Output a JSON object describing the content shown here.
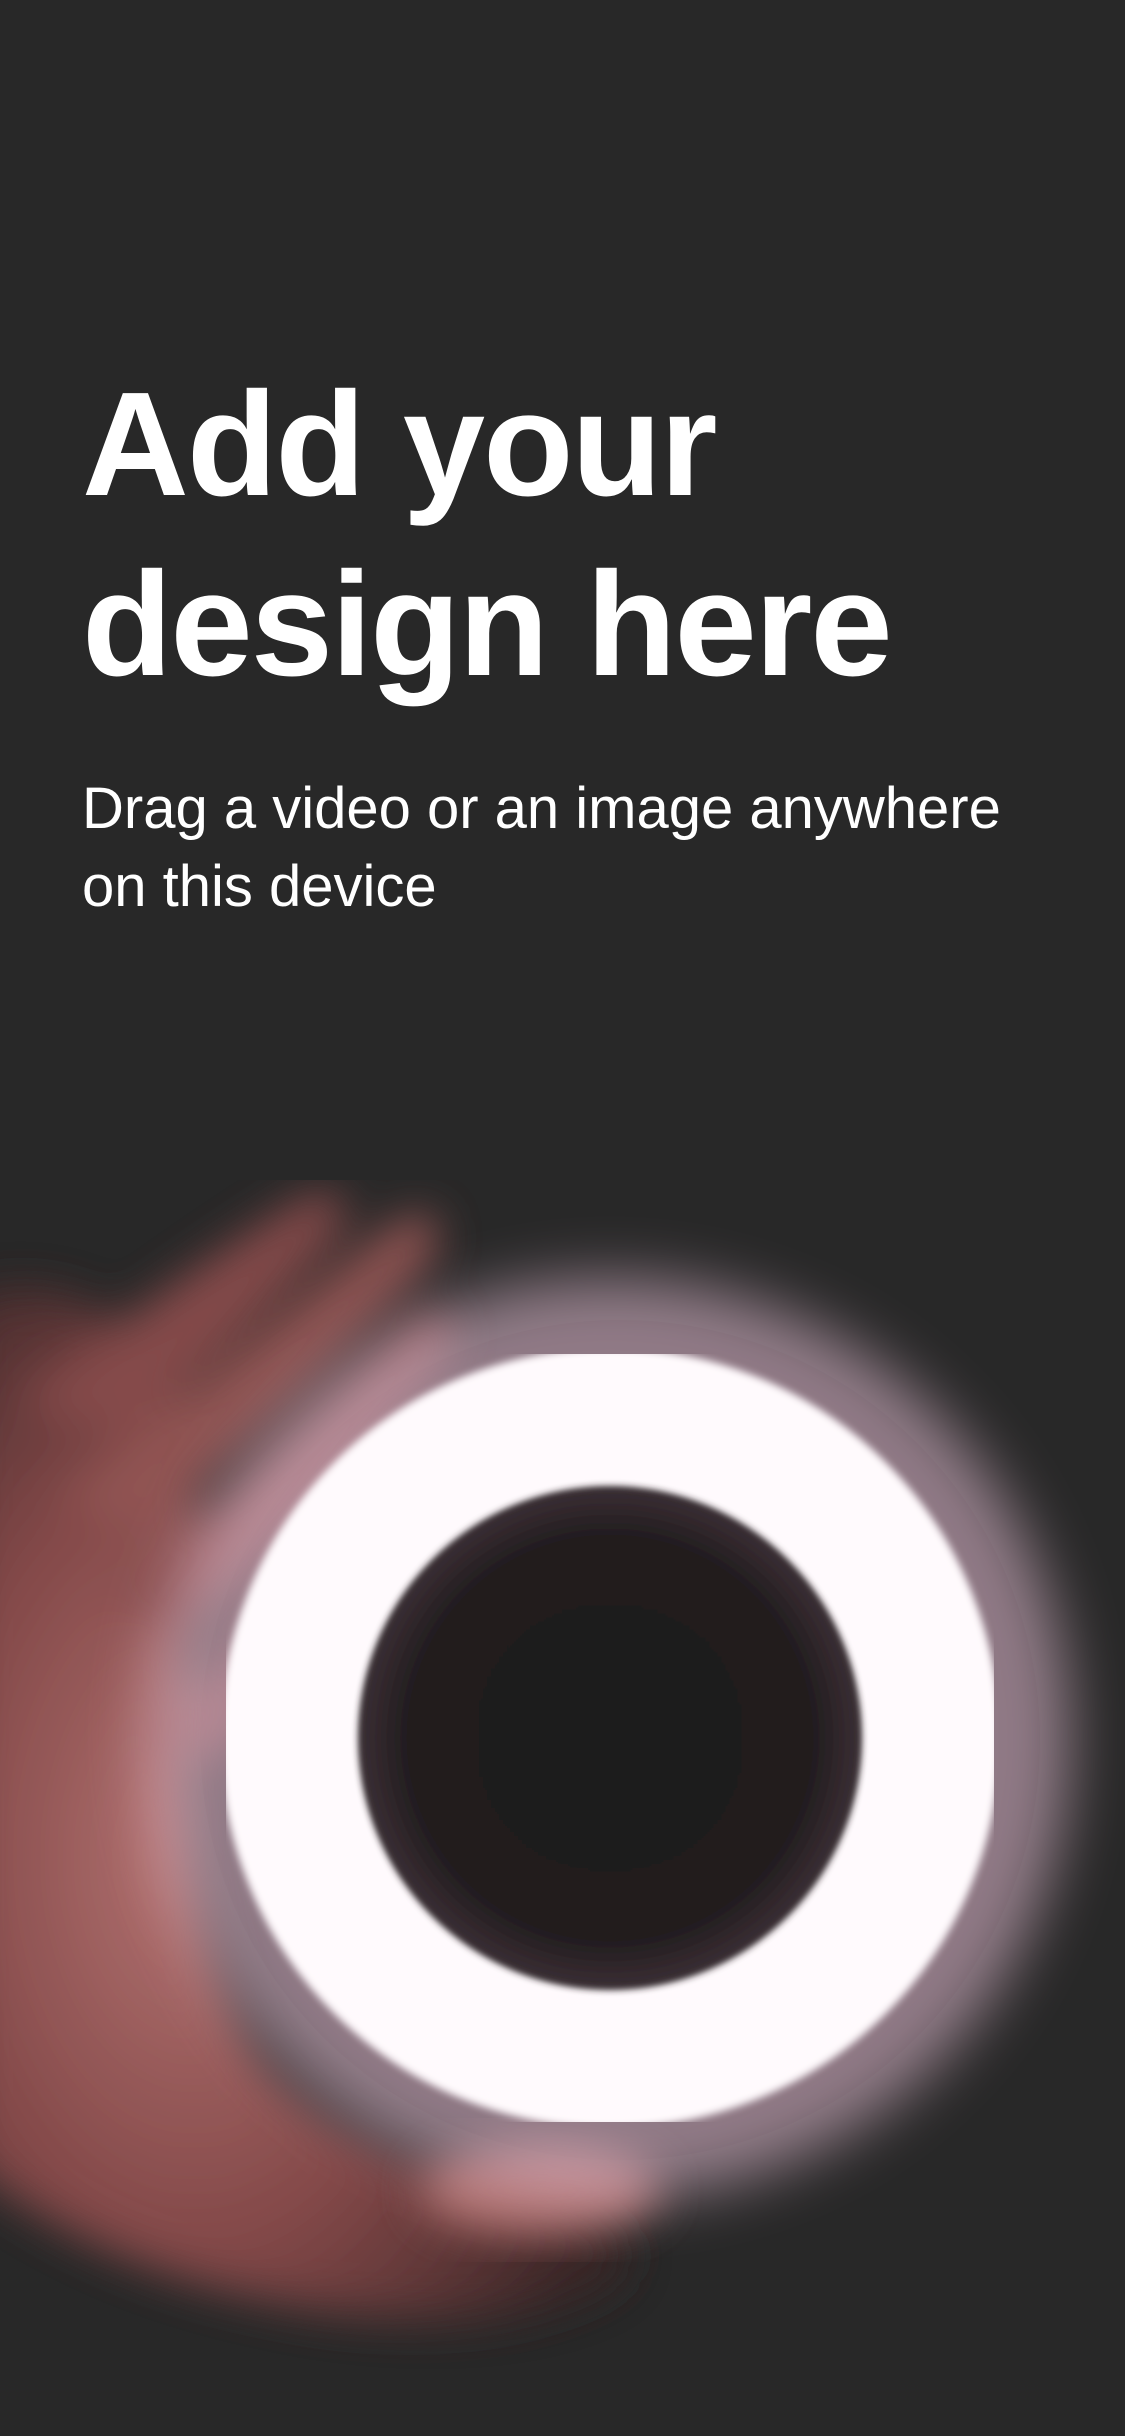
{
  "screen": {
    "background_color": "#282828",
    "text_color": "#ffffff"
  },
  "headline": {
    "line1": "Add your",
    "line2": "design here"
  },
  "subtitle": {
    "line1": "Drag a video or an image anywhere",
    "line2": "on this device"
  },
  "photo": {
    "subject": "hand-holding-ring-light",
    "ring_color": "#fffafd",
    "ring_glow_color": "#e9c3d8",
    "hand_color": "#b36a69"
  }
}
